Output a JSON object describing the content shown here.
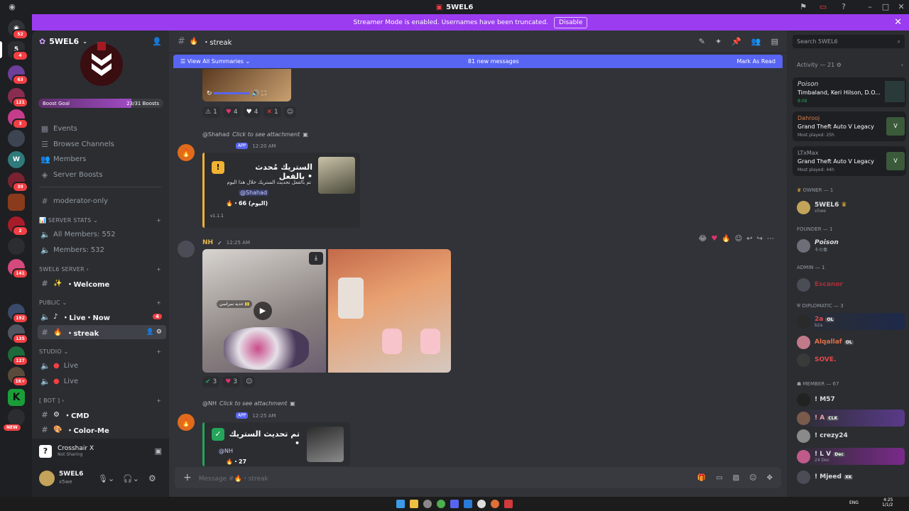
{
  "titlebar": {
    "title": "5WEL6"
  },
  "banner": {
    "text": "Streamer Mode is enabled. Usernames have been truncated.",
    "button": "Disable"
  },
  "servers": [
    {
      "badge": "52"
    },
    {
      "badge": "4"
    },
    {
      "badge": "63"
    },
    {
      "badge": "121"
    },
    {
      "badge": "3"
    },
    {
      "badge": ""
    },
    {
      "badge": ""
    },
    {
      "badge": "39"
    },
    {
      "badge": ""
    },
    {
      "badge": "2"
    },
    {
      "badge": ""
    },
    {
      "badge": "141"
    },
    {
      "badge": "192"
    },
    {
      "badge": "135"
    },
    {
      "badge": "127"
    },
    {
      "badge": "1K+"
    },
    {
      "badge": ""
    },
    {
      "badge": "NEW"
    }
  ],
  "sidebar": {
    "server_name": "5WEL6",
    "boost_goal": "Boost Goal",
    "boost_count": "23/31 Boosts",
    "boost_progress": 0.742,
    "nav": [
      "Events",
      "Browse Channels",
      "Members",
      "Server Boosts"
    ],
    "moderator": "moderator-only",
    "cat_stats": "SERVER STATS",
    "all_members": "All Members: 552",
    "members_count": "Members: 532",
    "cat_server": "5WEL6 Server",
    "welcome": "・Welcome",
    "cat_public": "Public",
    "live_now": "・Live・Now",
    "live_badge": "4",
    "streak": "・streak",
    "cat_studio": "studio",
    "live1": "Live",
    "live2": "Live",
    "cat_bot": "[ BOT ]",
    "cmd": "・CMD",
    "colorme": "・Color-Me",
    "activity_title": "Crosshair X",
    "activity_sub": "Not Sharing",
    "user_name": "5WEL6",
    "user_status": "x5we"
  },
  "channel": {
    "name": "・streak",
    "summaries": "View All Summaries",
    "new_messages": "81 new messages",
    "mark_read": "Mark As Read",
    "composer": "Message #🔥・streak"
  },
  "messages": {
    "reacts1": [
      "1",
      "4",
      "4",
      "1"
    ],
    "reply1_user": "@Shahad",
    "reply1_text": "Click to see attachment",
    "app_tag": "APP",
    "time1": "12:20 AM",
    "embed1_title": "الستريك مُحدث بالفعل •",
    "embed1_line1": "تم بالفعل تحديث الستريك خلال هذا اليوم",
    "embed1_mention": "@Shahad",
    "embed1_count": "66 (اليوم)",
    "embed1_version": "v1.1.1",
    "msg2_user": "NH",
    "msg2_time": "12:25 AM",
    "voice_label": "حديه سراسي",
    "reacts2": [
      "3",
      "3"
    ],
    "reply2_user": "@NH",
    "reply2_text": "Click to see attachment",
    "time3": "12:25 AM",
    "embed2_title": "تم تحديث الستريك •",
    "embed2_mention": "@NH",
    "embed2_count": "27"
  },
  "members": {
    "search": "Search 5WEL6",
    "activity_header": "Activity — 21",
    "act1_name": "Poison",
    "act1_game": "Timbaland, Keri Hilson, D.O...",
    "act1_time": "8:08",
    "act2_name": "Dahrooj",
    "act2_game": "Grand Theft Auto V Legacy",
    "act2_sub": "Most played: 25h",
    "act3_name": "LTxMax",
    "act3_game": "Grand Theft Auto V Legacy",
    "act3_sub": "Most played: 44h",
    "owner_cat": "OWNER — 1",
    "owner_name": "5WEL6",
    "owner_sub": "x5we",
    "founder_cat": "FOUNDER — 1",
    "founder_name": "Poison",
    "founder_sub": "その毒",
    "admin_cat": "ADMIN — 1",
    "admin_name": "Escanor",
    "diplo_cat": "DIPLOMATIC — 3",
    "d1_name": "2a",
    "d1_tag": "OL",
    "d1_sub": "b2a",
    "d2_name": "Alqallaf",
    "d2_tag": "OL",
    "d3_name": "SOVE.",
    "member_cat": "Member — 67",
    "m1": "! M57",
    "m2": "! A",
    "m2_tag": "CLK",
    "m3": "! crezy24",
    "m4": "! L V",
    "m4_tag": "Dec",
    "m4_sub": "24 Dec",
    "m5": "! Mjeed",
    "m5_tag": "XK"
  },
  "taskbar": {
    "lang": "ENG",
    "time": "4:25",
    "date": "1/1/2"
  },
  "colors": {
    "accent": "#5865f2",
    "banner": "#9b3cf0",
    "danger": "#f23f43",
    "green": "#23a55a",
    "warning": "#f0b232"
  }
}
